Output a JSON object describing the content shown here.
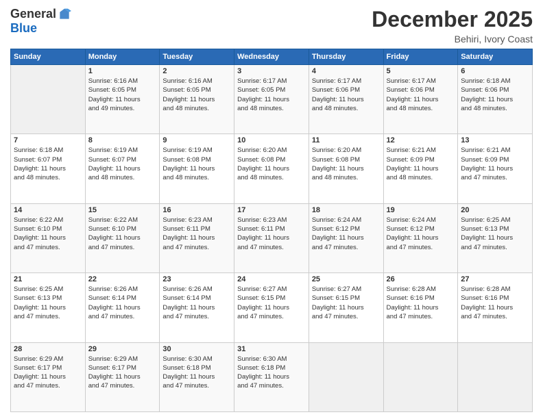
{
  "header": {
    "logo_general": "General",
    "logo_blue": "Blue",
    "month_title": "December 2025",
    "location": "Behiri, Ivory Coast"
  },
  "days_of_week": [
    "Sunday",
    "Monday",
    "Tuesday",
    "Wednesday",
    "Thursday",
    "Friday",
    "Saturday"
  ],
  "weeks": [
    [
      {
        "day": "",
        "info": ""
      },
      {
        "day": "1",
        "info": "Sunrise: 6:16 AM\nSunset: 6:05 PM\nDaylight: 11 hours\nand 49 minutes."
      },
      {
        "day": "2",
        "info": "Sunrise: 6:16 AM\nSunset: 6:05 PM\nDaylight: 11 hours\nand 48 minutes."
      },
      {
        "day": "3",
        "info": "Sunrise: 6:17 AM\nSunset: 6:05 PM\nDaylight: 11 hours\nand 48 minutes."
      },
      {
        "day": "4",
        "info": "Sunrise: 6:17 AM\nSunset: 6:06 PM\nDaylight: 11 hours\nand 48 minutes."
      },
      {
        "day": "5",
        "info": "Sunrise: 6:17 AM\nSunset: 6:06 PM\nDaylight: 11 hours\nand 48 minutes."
      },
      {
        "day": "6",
        "info": "Sunrise: 6:18 AM\nSunset: 6:06 PM\nDaylight: 11 hours\nand 48 minutes."
      }
    ],
    [
      {
        "day": "7",
        "info": "Sunrise: 6:18 AM\nSunset: 6:07 PM\nDaylight: 11 hours\nand 48 minutes."
      },
      {
        "day": "8",
        "info": "Sunrise: 6:19 AM\nSunset: 6:07 PM\nDaylight: 11 hours\nand 48 minutes."
      },
      {
        "day": "9",
        "info": "Sunrise: 6:19 AM\nSunset: 6:08 PM\nDaylight: 11 hours\nand 48 minutes."
      },
      {
        "day": "10",
        "info": "Sunrise: 6:20 AM\nSunset: 6:08 PM\nDaylight: 11 hours\nand 48 minutes."
      },
      {
        "day": "11",
        "info": "Sunrise: 6:20 AM\nSunset: 6:08 PM\nDaylight: 11 hours\nand 48 minutes."
      },
      {
        "day": "12",
        "info": "Sunrise: 6:21 AM\nSunset: 6:09 PM\nDaylight: 11 hours\nand 48 minutes."
      },
      {
        "day": "13",
        "info": "Sunrise: 6:21 AM\nSunset: 6:09 PM\nDaylight: 11 hours\nand 47 minutes."
      }
    ],
    [
      {
        "day": "14",
        "info": "Sunrise: 6:22 AM\nSunset: 6:10 PM\nDaylight: 11 hours\nand 47 minutes."
      },
      {
        "day": "15",
        "info": "Sunrise: 6:22 AM\nSunset: 6:10 PM\nDaylight: 11 hours\nand 47 minutes."
      },
      {
        "day": "16",
        "info": "Sunrise: 6:23 AM\nSunset: 6:11 PM\nDaylight: 11 hours\nand 47 minutes."
      },
      {
        "day": "17",
        "info": "Sunrise: 6:23 AM\nSunset: 6:11 PM\nDaylight: 11 hours\nand 47 minutes."
      },
      {
        "day": "18",
        "info": "Sunrise: 6:24 AM\nSunset: 6:12 PM\nDaylight: 11 hours\nand 47 minutes."
      },
      {
        "day": "19",
        "info": "Sunrise: 6:24 AM\nSunset: 6:12 PM\nDaylight: 11 hours\nand 47 minutes."
      },
      {
        "day": "20",
        "info": "Sunrise: 6:25 AM\nSunset: 6:13 PM\nDaylight: 11 hours\nand 47 minutes."
      }
    ],
    [
      {
        "day": "21",
        "info": "Sunrise: 6:25 AM\nSunset: 6:13 PM\nDaylight: 11 hours\nand 47 minutes."
      },
      {
        "day": "22",
        "info": "Sunrise: 6:26 AM\nSunset: 6:14 PM\nDaylight: 11 hours\nand 47 minutes."
      },
      {
        "day": "23",
        "info": "Sunrise: 6:26 AM\nSunset: 6:14 PM\nDaylight: 11 hours\nand 47 minutes."
      },
      {
        "day": "24",
        "info": "Sunrise: 6:27 AM\nSunset: 6:15 PM\nDaylight: 11 hours\nand 47 minutes."
      },
      {
        "day": "25",
        "info": "Sunrise: 6:27 AM\nSunset: 6:15 PM\nDaylight: 11 hours\nand 47 minutes."
      },
      {
        "day": "26",
        "info": "Sunrise: 6:28 AM\nSunset: 6:16 PM\nDaylight: 11 hours\nand 47 minutes."
      },
      {
        "day": "27",
        "info": "Sunrise: 6:28 AM\nSunset: 6:16 PM\nDaylight: 11 hours\nand 47 minutes."
      }
    ],
    [
      {
        "day": "28",
        "info": "Sunrise: 6:29 AM\nSunset: 6:17 PM\nDaylight: 11 hours\nand 47 minutes."
      },
      {
        "day": "29",
        "info": "Sunrise: 6:29 AM\nSunset: 6:17 PM\nDaylight: 11 hours\nand 47 minutes."
      },
      {
        "day": "30",
        "info": "Sunrise: 6:30 AM\nSunset: 6:18 PM\nDaylight: 11 hours\nand 47 minutes."
      },
      {
        "day": "31",
        "info": "Sunrise: 6:30 AM\nSunset: 6:18 PM\nDaylight: 11 hours\nand 47 minutes."
      },
      {
        "day": "",
        "info": ""
      },
      {
        "day": "",
        "info": ""
      },
      {
        "day": "",
        "info": ""
      }
    ]
  ]
}
